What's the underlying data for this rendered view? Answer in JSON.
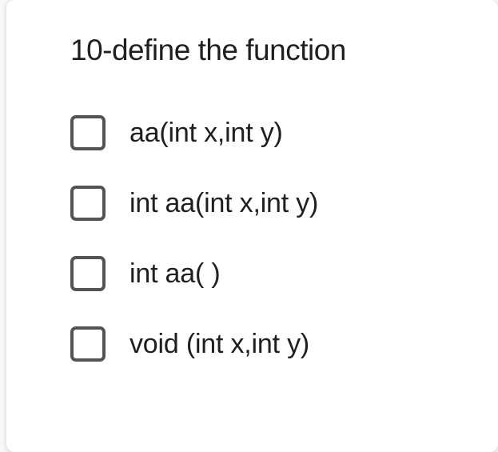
{
  "question": {
    "title": "10-define the function",
    "options": [
      {
        "label": "aa(int x,int y)"
      },
      {
        "label": "int aa(int x,int y)"
      },
      {
        "label": "int aa( )"
      },
      {
        "label": "void (int x,int y)"
      }
    ]
  }
}
